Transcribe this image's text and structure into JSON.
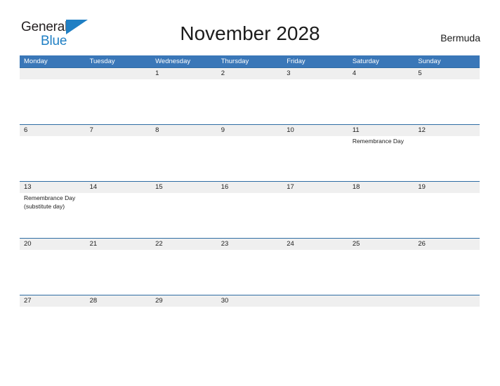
{
  "brand": {
    "name_part1": "General",
    "name_part2": "Blue",
    "flag_icon": "blue-triangle-flag-icon",
    "color_dark": "#231f20",
    "color_blue": "#1f7fc4"
  },
  "header": {
    "title": "November 2028",
    "locale": "Bermuda"
  },
  "theme": {
    "header_blue": "#3a77b8",
    "rule_blue": "#2e6ca3",
    "band_gray": "#efefef",
    "text": "#1c1c1c"
  },
  "calendar": {
    "month": "November",
    "year": "2028",
    "weekdays": [
      "Monday",
      "Tuesday",
      "Wednesday",
      "Thursday",
      "Friday",
      "Saturday",
      "Sunday"
    ],
    "weeks": [
      [
        {
          "day": "",
          "events": []
        },
        {
          "day": "",
          "events": []
        },
        {
          "day": "1",
          "events": []
        },
        {
          "day": "2",
          "events": []
        },
        {
          "day": "3",
          "events": []
        },
        {
          "day": "4",
          "events": []
        },
        {
          "day": "5",
          "events": []
        }
      ],
      [
        {
          "day": "6",
          "events": []
        },
        {
          "day": "7",
          "events": []
        },
        {
          "day": "8",
          "events": []
        },
        {
          "day": "9",
          "events": []
        },
        {
          "day": "10",
          "events": []
        },
        {
          "day": "11",
          "events": [
            "Remembrance Day"
          ]
        },
        {
          "day": "12",
          "events": []
        }
      ],
      [
        {
          "day": "13",
          "events": [
            "Remembrance Day",
            "(substitute day)"
          ]
        },
        {
          "day": "14",
          "events": []
        },
        {
          "day": "15",
          "events": []
        },
        {
          "day": "16",
          "events": []
        },
        {
          "day": "17",
          "events": []
        },
        {
          "day": "18",
          "events": []
        },
        {
          "day": "19",
          "events": []
        }
      ],
      [
        {
          "day": "20",
          "events": []
        },
        {
          "day": "21",
          "events": []
        },
        {
          "day": "22",
          "events": []
        },
        {
          "day": "23",
          "events": []
        },
        {
          "day": "24",
          "events": []
        },
        {
          "day": "25",
          "events": []
        },
        {
          "day": "26",
          "events": []
        }
      ],
      [
        {
          "day": "27",
          "events": []
        },
        {
          "day": "28",
          "events": []
        },
        {
          "day": "29",
          "events": []
        },
        {
          "day": "30",
          "events": []
        },
        {
          "day": "",
          "events": []
        },
        {
          "day": "",
          "events": []
        },
        {
          "day": "",
          "events": []
        }
      ]
    ]
  }
}
